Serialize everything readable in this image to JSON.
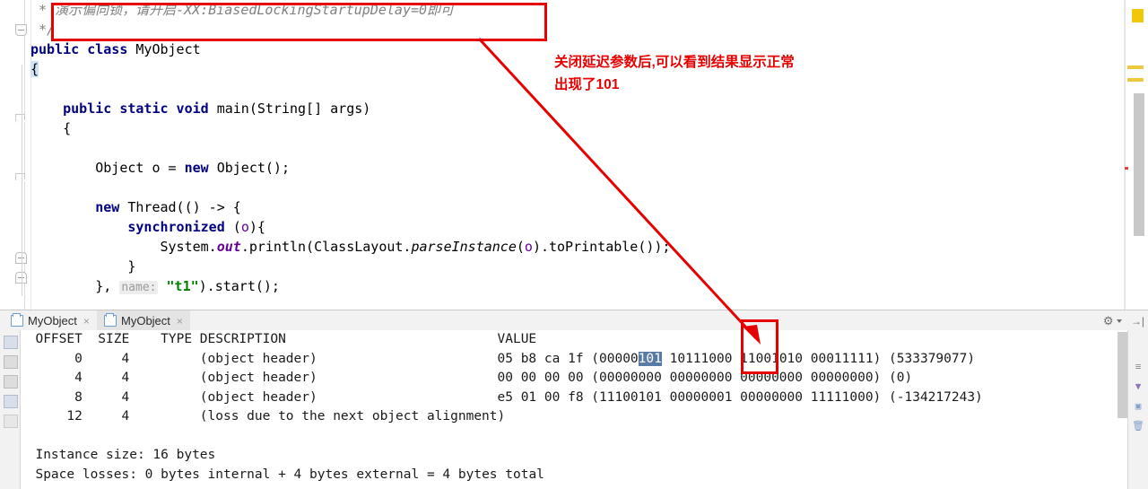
{
  "editor": {
    "lines": [
      {
        "id": "l1",
        "segments": [
          {
            "t": " * ",
            "c": "cm"
          },
          {
            "t": "演示偏向锁，请开启-XX:BiasedLockingStartupDelay=0即可",
            "c": "cm"
          }
        ]
      },
      {
        "id": "l2",
        "segments": [
          {
            "t": " */",
            "c": "cm"
          }
        ]
      },
      {
        "id": "l3",
        "segments": [
          {
            "t": "public class ",
            "c": "kw"
          },
          {
            "t": "MyObject",
            "c": ""
          }
        ]
      },
      {
        "id": "l4",
        "segments": [
          {
            "t": "{",
            "c": "brk"
          }
        ]
      },
      {
        "id": "l5",
        "segments": [
          {
            "t": "",
            "c": ""
          }
        ]
      },
      {
        "id": "l6",
        "segments": [
          {
            "t": "    ",
            "c": ""
          },
          {
            "t": "public static void ",
            "c": "kw"
          },
          {
            "t": "main(String[] args)",
            "c": ""
          }
        ]
      },
      {
        "id": "l7",
        "segments": [
          {
            "t": "    {",
            "c": ""
          }
        ]
      },
      {
        "id": "l8",
        "segments": [
          {
            "t": "",
            "c": ""
          }
        ]
      },
      {
        "id": "l9",
        "segments": [
          {
            "t": "        Object o = ",
            "c": ""
          },
          {
            "t": "new",
            "c": "kw"
          },
          {
            "t": " Object();",
            "c": ""
          }
        ]
      },
      {
        "id": "l10",
        "segments": [
          {
            "t": "",
            "c": ""
          }
        ]
      },
      {
        "id": "l11",
        "segments": [
          {
            "t": "        ",
            "c": ""
          },
          {
            "t": "new",
            "c": "kw"
          },
          {
            "t": " Thread(() -> {",
            "c": ""
          }
        ]
      },
      {
        "id": "l12",
        "segments": [
          {
            "t": "            ",
            "c": ""
          },
          {
            "t": "synchronized",
            "c": "kw"
          },
          {
            "t": " (",
            "c": ""
          },
          {
            "t": "o",
            "c": "prm"
          },
          {
            "t": "){",
            "c": ""
          }
        ]
      },
      {
        "id": "l13",
        "segments": [
          {
            "t": "                System.",
            "c": ""
          },
          {
            "t": "out",
            "c": "fld"
          },
          {
            "t": ".println(ClassLayout.",
            "c": ""
          },
          {
            "t": "parseInstance",
            "c": "mth"
          },
          {
            "t": "(",
            "c": ""
          },
          {
            "t": "o",
            "c": "prm"
          },
          {
            "t": ").toPrintable());",
            "c": ""
          }
        ]
      },
      {
        "id": "l14",
        "segments": [
          {
            "t": "            }",
            "c": ""
          }
        ]
      },
      {
        "id": "l15",
        "segments": [
          {
            "t": "        }, ",
            "c": ""
          },
          {
            "t": "name:",
            "c": "hint"
          },
          {
            "t": " ",
            "c": ""
          },
          {
            "t": "\"t1\"",
            "c": "str"
          },
          {
            "t": ").start();",
            "c": ""
          }
        ]
      },
      {
        "id": "l16",
        "segments": [
          {
            "t": "",
            "c": ""
          }
        ]
      },
      {
        "id": "l17",
        "segments": [
          {
            "t": "    }",
            "c": ""
          }
        ]
      },
      {
        "id": "l18",
        "segments": [
          {
            "t": "",
            "c": ""
          }
        ]
      },
      {
        "id": "l19",
        "segments": [
          {
            "t": "}",
            "c": "brk"
          }
        ],
        "current": true
      }
    ]
  },
  "tabs": {
    "items": [
      {
        "label": "MyObject",
        "active": false,
        "close": "×"
      },
      {
        "label": "MyObject",
        "active": true,
        "close": "×"
      }
    ],
    "tools": {
      "gear": "⚙",
      "hide": "→|"
    }
  },
  "console": {
    "header": {
      "offset": "OFFSET",
      "size": "SIZE",
      "type": "TYPE",
      "description": "DESCRIPTION",
      "value": "VALUE"
    },
    "rows": [
      {
        "offset": "0",
        "size": "4",
        "type": "",
        "description": "(object header)",
        "hex": "05 b8 ca 1f",
        "bits_pre": "(00000",
        "bits_sel": "101",
        "bits_post": " 10111000 11001010 00011111)",
        "decimal": "(533379077)"
      },
      {
        "offset": "4",
        "size": "4",
        "type": "",
        "description": "(object header)",
        "hex": "00 00 00 00",
        "bits_pre": "(00000000",
        "bits_sel": "",
        "bits_post": " 00000000 00000000 00000000)",
        "decimal": "(0)"
      },
      {
        "offset": "8",
        "size": "4",
        "type": "",
        "description": "(object header)",
        "hex": "e5 01 00 f8",
        "bits_pre": "(11100101",
        "bits_sel": "",
        "bits_post": " 00000001 00000000 11111000)",
        "decimal": "(-134217243)"
      },
      {
        "offset": "12",
        "size": "4",
        "type": "",
        "description": "(loss due to the next object alignment)",
        "hex": "",
        "bits_pre": "",
        "bits_sel": "",
        "bits_post": "",
        "decimal": ""
      }
    ],
    "summary_1": "Instance size: 16 bytes",
    "summary_2": "Space losses: 0 bytes internal + 4 bytes external = 4 bytes total"
  },
  "annotations": {
    "callout_text": "关闭延迟参数后,可以看到结果显示正常\n出现了101",
    "color": "#e60000",
    "box_comment_name": "comment-highlight-box",
    "box_value_name": "value-highlight-box"
  },
  "colors": {
    "annotation_red": "#e60000",
    "current_line": "#fcfae3",
    "selection_blue": "#5a7aa6",
    "bracket_match": "#cfe3f7",
    "warning_marker": "#f0c808"
  }
}
